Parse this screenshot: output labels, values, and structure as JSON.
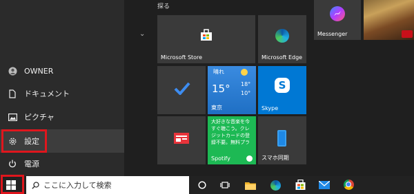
{
  "start_menu": {
    "group_label": "探る",
    "rail": [
      {
        "label": "OWNER",
        "icon": "user-icon"
      },
      {
        "label": "ドキュメント",
        "icon": "document-icon"
      },
      {
        "label": "ピクチャ",
        "icon": "picture-icon"
      },
      {
        "label": "設定",
        "icon": "gear-icon"
      },
      {
        "label": "電源",
        "icon": "power-icon"
      }
    ],
    "tiles": {
      "messenger": "Messenger",
      "store": "Microsoft Store",
      "edge": "Microsoft Edge",
      "weather": {
        "condition": "晴れ",
        "temp": "15°",
        "high": "18°",
        "low": "10°",
        "location": "東京"
      },
      "skype": "Skype",
      "spotify": {
        "name": "Spotify",
        "promo": "大好きな音楽を今すぐ聴こう。クレジットカードの登録不要。無料プランも"
      },
      "phone": "スマホ同期"
    }
  },
  "taskbar": {
    "search_placeholder": "ここに入力して検索",
    "icons": [
      "windows-start-icon",
      "cortana-icon",
      "task-view-icon",
      "file-explorer-icon",
      "edge-icon",
      "store-icon",
      "mail-icon",
      "chrome-icon"
    ]
  },
  "colors": {
    "highlight": "#e0161d",
    "skype": "#0078d4",
    "spotify": "#1db954",
    "weather": "#2a7fd6"
  }
}
